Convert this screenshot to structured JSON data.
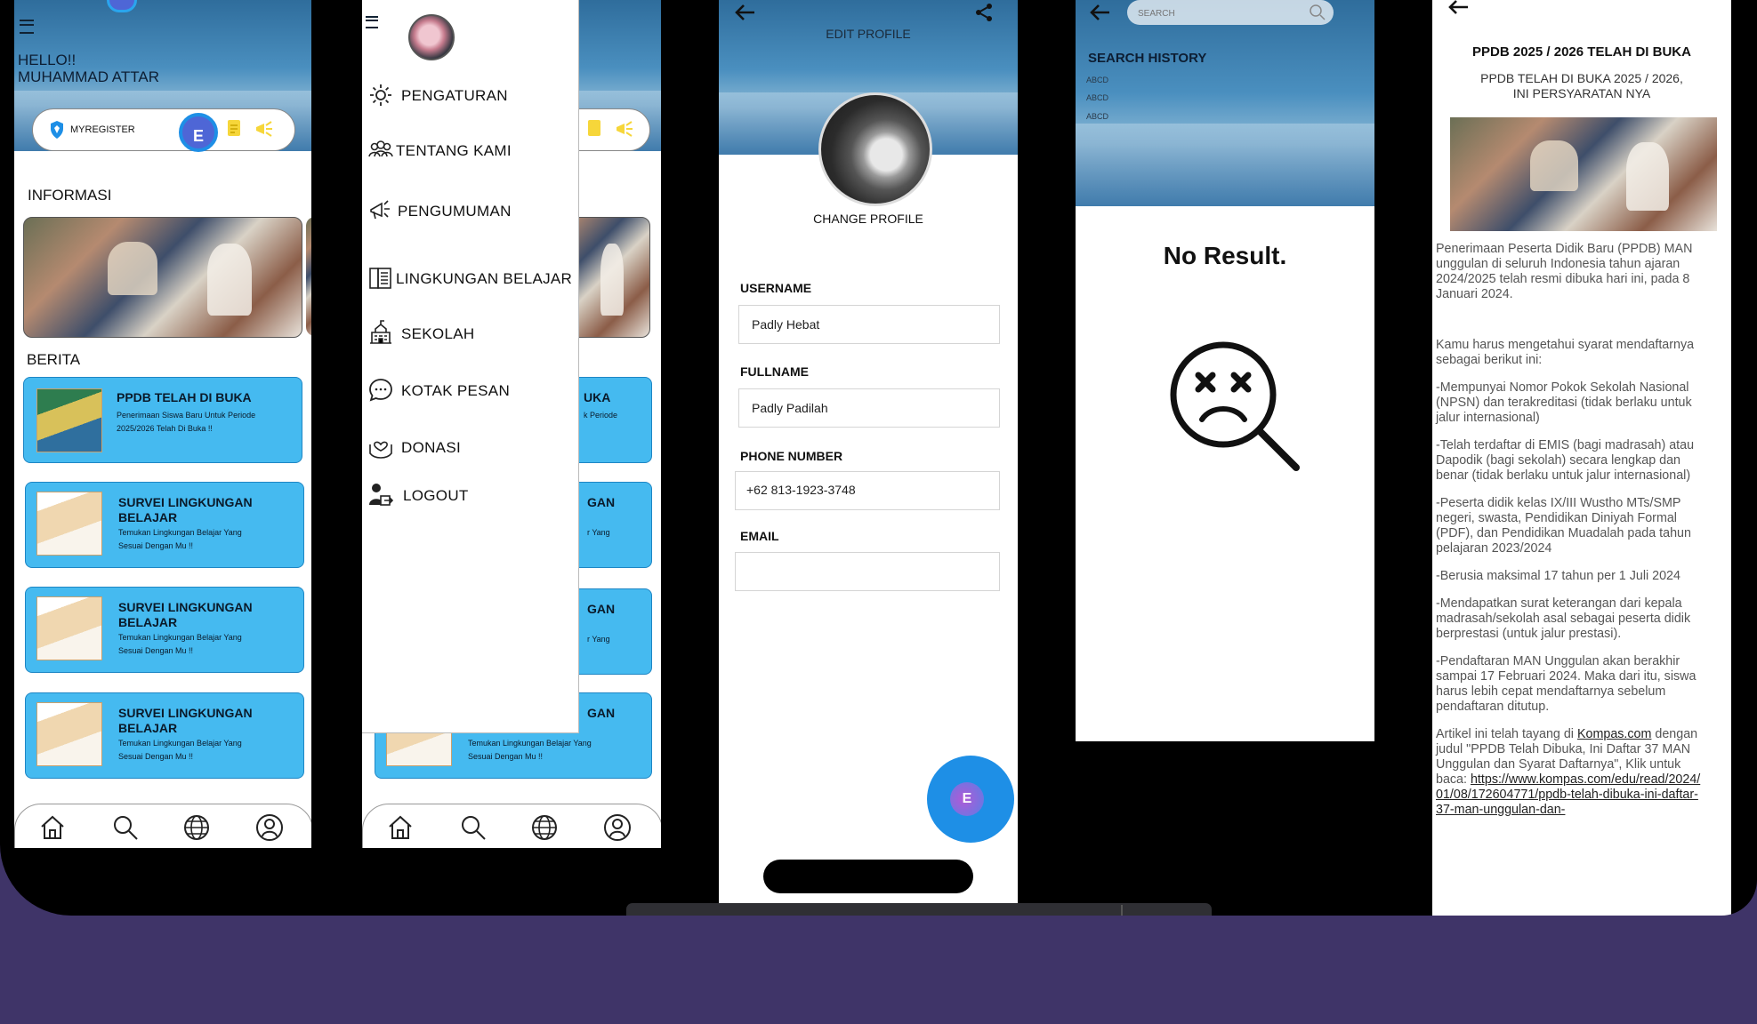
{
  "home": {
    "greeting_line1": "HELLO!!",
    "greeting_line2": "MUHAMMAD ATTAR",
    "myregister_label": "MYREGISTER",
    "avatar_letter": "E",
    "section_info": "INFORMASI",
    "section_news": "BERITA",
    "news": [
      {
        "title": "PPDB TELAH DI BUKA",
        "sub1": "Penerimaan Siswa Baru Untuk Periode",
        "sub2": "2025/2026 Telah Di Buka !!"
      },
      {
        "title": "SURVEI LINGKUNGAN",
        "title2": "BELAJAR",
        "sub1": "Temukan Lingkungan Belajar Yang",
        "sub2": "Sesuai Dengan Mu !!"
      },
      {
        "title": "SURVEI LINGKUNGAN",
        "title2": "BELAJAR",
        "sub1": "Temukan Lingkungan Belajar Yang",
        "sub2": "Sesuai Dengan Mu !!"
      },
      {
        "title": "SURVEI LINGKUNGAN",
        "title2": "BELAJAR",
        "sub1": "Temukan Lingkungan Belajar Yang",
        "sub2": "Sesuai Dengan Mu !!"
      }
    ]
  },
  "drawer": {
    "items": [
      {
        "label": "PENGATURAN"
      },
      {
        "label": "TENTANG KAMI"
      },
      {
        "label": "PENGUMUMAN"
      },
      {
        "label": "LINGKUNGAN BELAJAR"
      },
      {
        "label": "SEKOLAH"
      },
      {
        "label": "KOTAK PESAN"
      },
      {
        "label": "DONASI"
      },
      {
        "label": "LOGOUT"
      }
    ],
    "peek": {
      "ka": "UKA",
      "periode": "k Periode",
      "gan": "GAN",
      "yang": "r Yang",
      "card4_sub1": "Temukan Lingkungan Belajar Yang",
      "card4_sub2": "Sesuai Dengan Mu !!"
    }
  },
  "profile": {
    "title": "EDIT PROFILE",
    "change_label": "CHANGE PROFILE",
    "username_label": "USERNAME",
    "username_value": "Padly Hebat",
    "fullname_label": "FULLNAME",
    "fullname_value": "Padly Padilah",
    "phone_label": "PHONE NUMBER",
    "phone_value": "+62 813-1923-3748",
    "email_label": "EMAIL",
    "email_value": "",
    "fab_letter": "E"
  },
  "search": {
    "placeholder": "SEARCH",
    "history_title": "SEARCH HISTORY",
    "history": [
      "ABCD",
      "ABCD",
      "ABCD"
    ],
    "empty_text": "No Result."
  },
  "article": {
    "title": "PPDB 2025 / 2026 TELAH DI BUKA",
    "subtitle1": "PPDB TELAH DI BUKA 2025 / 2026,",
    "subtitle2": "INI PERSYARATAN NYA",
    "p1": "Penerimaan Peserta Didik Baru (PPDB) MAN unggulan di seluruh Indonesia tahun ajaran 2024/2025 telah resmi dibuka hari ini, pada 8 Januari 2024.",
    "p2": "Kamu harus mengetahui syarat mendaftarnya sebagai berikut ini:",
    "p3": "-Mempunyai Nomor Pokok Sekolah Nasional (NPSN) dan terakreditasi (tidak berlaku untuk jalur internasional)",
    "p4": "-Telah terdaftar di EMIS (bagi madrasah) atau Dapodik (bagi sekolah) secara lengkap dan benar (tidak berlaku untuk jalur internasional)",
    "p5": "-Peserta didik kelas IX/III Wustho MTs/SMP negeri, swasta, Pendidikan Diniyah Formal (PDF), dan Pendidikan Muadalah pada tahun pelajaran 2023/2024",
    "p6": "-Berusia maksimal 17 tahun per 1 Juli 2024",
    "p7": "-Mendapatkan surat keterangan dari kepala madrasah/sekolah asal sebagai peserta didik berprestasi (untuk jalur prestasi).",
    "p8": "-Pendaftaran MAN Unggulan akan berakhir sampai 17 Februari 2024. Maka dari itu, siswa harus lebih cepat mendaftarnya sebelum pendaftaran ditutup.",
    "p9a": "Artikel ini telah tayang di",
    "p9_link": "Kompas.com",
    "p9b": "dengan judul \"PPDB Telah Dibuka, Ini Daftar 37 MAN Unggulan dan Syarat Daftarnya\", Klik untuk baca:",
    "p9_url": "https://www.kompas.com/edu/read/2024/01/08/172604771/ppdb-telah-dibuka-ini-daftar-37-man-unggulan-dan-"
  },
  "colors": {
    "background": "#3f3468",
    "card_blue": "#45baf0",
    "fab_blue": "#1e8fe6",
    "avatar_purple": "#4e66d6"
  }
}
